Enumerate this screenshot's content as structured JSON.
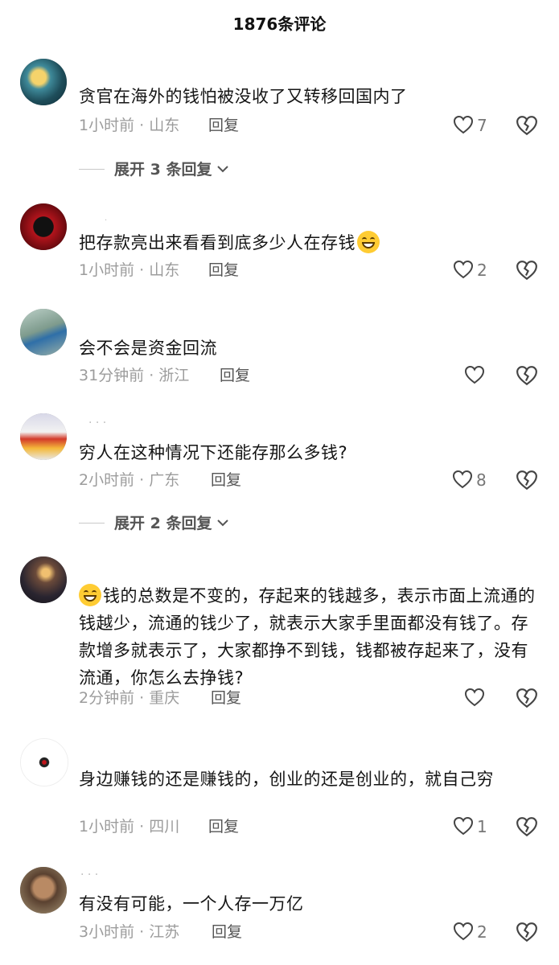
{
  "header": {
    "title": "1876条评论"
  },
  "comments": [
    {
      "text": "贪官在海外的钱怕被没收了又转移回国内了",
      "meta": "1小时前 · 山东",
      "reply": "回复",
      "likes": "7",
      "expand": "展开 3 条回复"
    },
    {
      "text": "把存款亮出来看看到底多少人在存钱",
      "meta": "1小时前 · 山东",
      "reply": "回复",
      "likes": "2"
    },
    {
      "text": "会不会是资金回流",
      "meta": "31分钟前 · 浙江",
      "reply": "回复",
      "likes": ""
    },
    {
      "text": "穷人在这种情况下还能存那么多钱?",
      "meta": "2小时前 · 广东",
      "reply": "回复",
      "likes": "8",
      "expand": "展开 2 条回复"
    },
    {
      "text": "钱的总数是不变的，存起来的钱越多，表示市面上流通的钱越少，流通的钱少了，就表示大家手里面都没有钱了。存款增多就表示了，大家都挣不到钱，钱都被存起来了，没有流通，你怎么去挣钱?",
      "meta": "2分钟前 · 重庆",
      "reply": "回复",
      "likes": ""
    },
    {
      "text": "身边赚钱的还是赚钱的，创业的还是创业的，就自己穷",
      "meta": "1小时前 · 四川",
      "reply": "回复",
      "likes": "1"
    },
    {
      "text": "有没有可能，一个人存一万亿",
      "meta": "3小时前 · 江苏",
      "reply": "回复",
      "likes": "2"
    }
  ],
  "icons": {
    "like": "heart-outline-icon",
    "dislike": "broken-heart-icon",
    "expand": "chevron-down-icon",
    "emoji_grin": "grinning-face-icon",
    "emoji_laugh": "laughing-tears-face-icon"
  }
}
